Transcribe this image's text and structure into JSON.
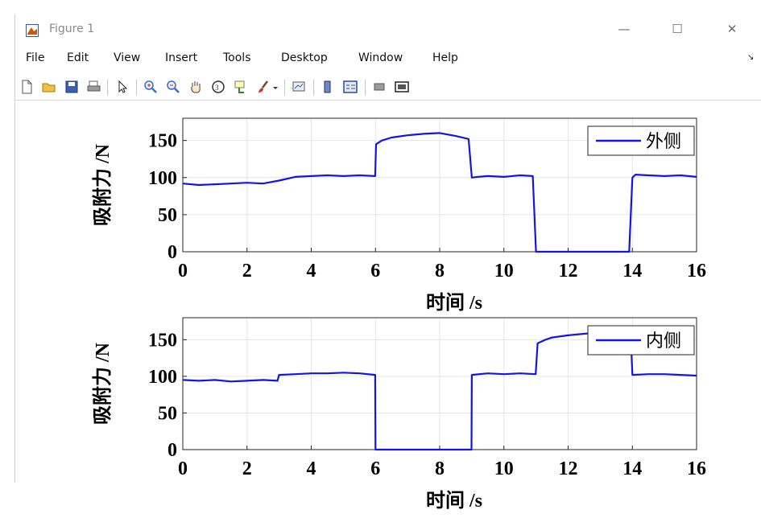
{
  "window": {
    "title": "Figure 1",
    "controls": [
      "—",
      "☐",
      "✕"
    ]
  },
  "menu": [
    "File",
    "Edit",
    "View",
    "Insert",
    "Tools",
    "Desktop",
    "Window",
    "Help"
  ],
  "toolbar": [
    "new-file-icon",
    "open-folder-icon",
    "save-icon",
    "print-icon",
    "pointer-icon",
    "zoom-in-icon",
    "zoom-out-icon",
    "pan-hand-icon",
    "rotate-3d-icon",
    "data-cursor-icon",
    "brush-icon",
    "brush-dropdown-icon",
    "link-plot-icon",
    "colorbar-icon",
    "legend-icon",
    "hide-plot-tools-icon",
    "show-plot-tools-icon"
  ],
  "colors": {
    "series": "#1414e6",
    "grid": "#e6e6e6",
    "axes": "#262626"
  },
  "chart_data": [
    {
      "type": "line",
      "xlabel": "时间 /s",
      "ylabel": "吸附力 /N",
      "xlim": [
        0,
        16
      ],
      "ylim": [
        0,
        180
      ],
      "xticks": [
        0,
        2,
        4,
        6,
        8,
        10,
        12,
        14,
        16
      ],
      "yticks": [
        0,
        50,
        100,
        150
      ],
      "grid": true,
      "legend_position": "top-right",
      "series": [
        {
          "name": "外侧",
          "x": [
            0,
            0.5,
            1,
            1.5,
            2,
            2.5,
            3,
            3.5,
            4,
            4.5,
            5,
            5.5,
            5.99,
            6.02,
            6.2,
            6.5,
            7,
            7.5,
            8,
            8.5,
            8.9,
            9.0,
            9.2,
            9.5,
            10,
            10.5,
            10.9,
            11.0,
            11.5,
            12,
            13,
            13.9,
            14.0,
            14.1,
            14.5,
            15,
            15.5,
            16
          ],
          "y": [
            92,
            90,
            91,
            92,
            93,
            92,
            96,
            101,
            102,
            103,
            102,
            103,
            102,
            145,
            150,
            154,
            157,
            159,
            160,
            156,
            152,
            100,
            101,
            102,
            101,
            103,
            102,
            0,
            0,
            0,
            0,
            0,
            100,
            104,
            103,
            102,
            103,
            101
          ]
        }
      ]
    },
    {
      "type": "line",
      "xlabel": "时间 /s",
      "ylabel": "吸附力 /N",
      "xlim": [
        0,
        16
      ],
      "ylim": [
        0,
        180
      ],
      "xticks": [
        0,
        2,
        4,
        6,
        8,
        10,
        12,
        14,
        16
      ],
      "yticks": [
        0,
        50,
        100,
        150
      ],
      "grid": true,
      "legend_position": "top-right",
      "series": [
        {
          "name": "内侧",
          "x": [
            0,
            0.5,
            1,
            1.5,
            2,
            2.5,
            2.95,
            3.0,
            3.5,
            4,
            4.5,
            5,
            5.5,
            5.99,
            6.0,
            6.5,
            7,
            8,
            8.99,
            9.0,
            9.5,
            10,
            10.5,
            10.99,
            11.05,
            11.3,
            11.5,
            12,
            12.5,
            13,
            13.5,
            13.95,
            14.0,
            14.5,
            15,
            15.5,
            16
          ],
          "y": [
            95,
            94,
            95,
            93,
            94,
            95,
            94,
            102,
            103,
            104,
            104,
            105,
            104,
            102,
            0,
            0,
            0,
            0,
            0,
            102,
            104,
            103,
            104,
            103,
            145,
            150,
            153,
            156,
            158,
            160,
            158,
            155,
            102,
            103,
            103,
            102,
            101
          ]
        }
      ]
    }
  ]
}
